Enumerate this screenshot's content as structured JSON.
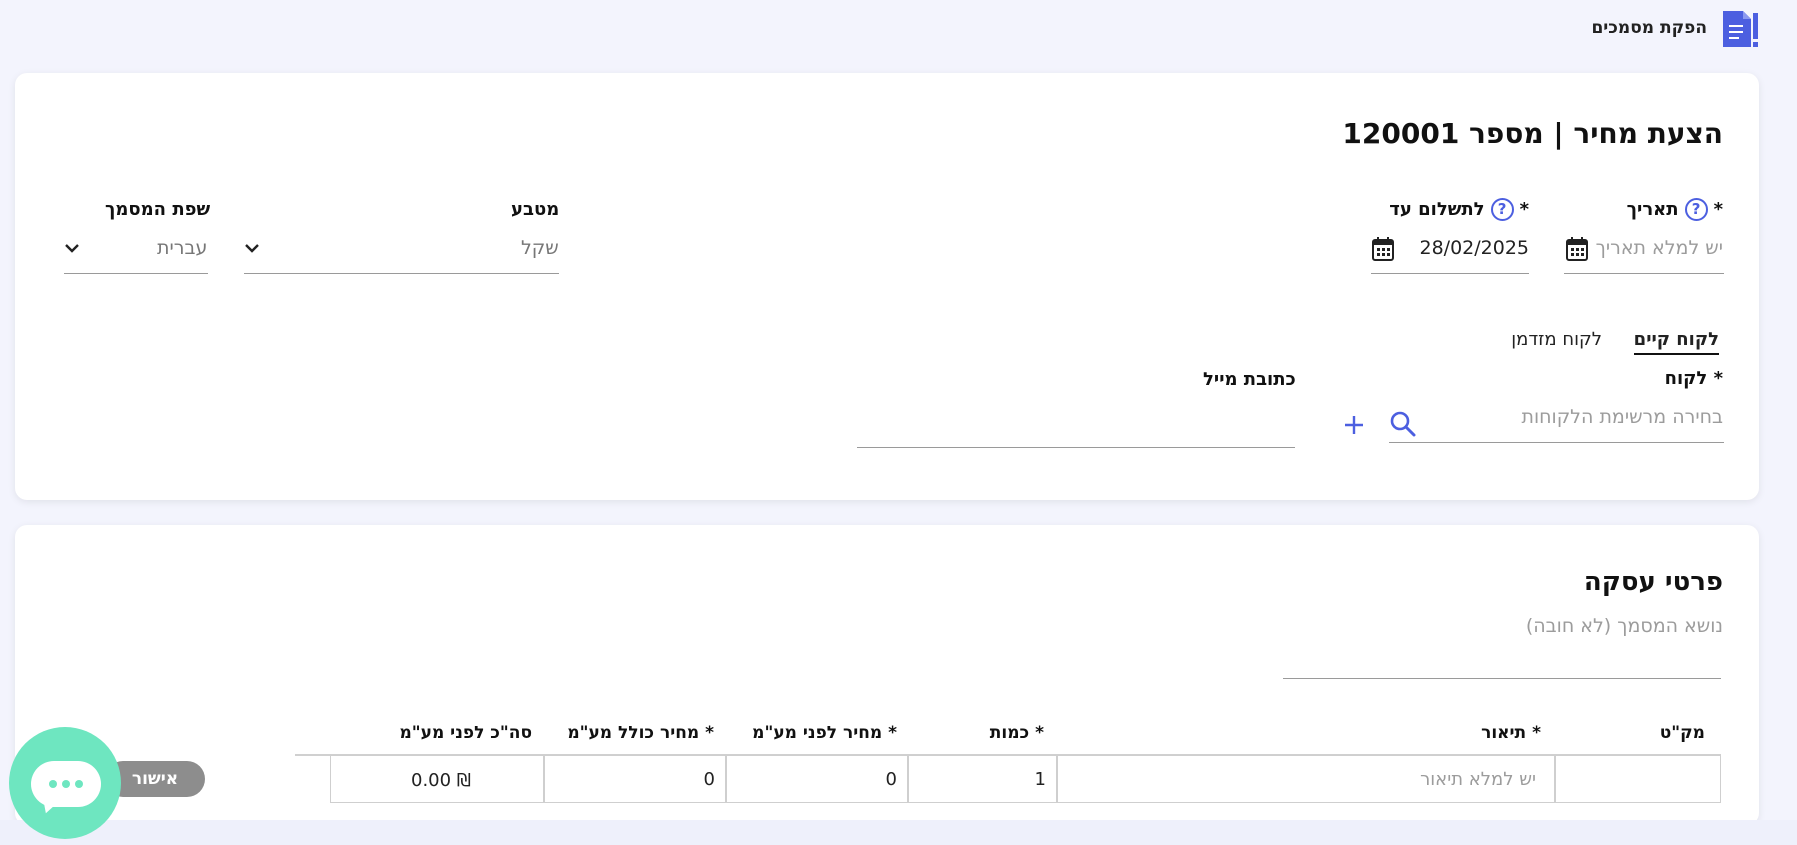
{
  "header": {
    "app_title": "הפקת מסמכים",
    "icon": "document-icon"
  },
  "document": {
    "title": "הצעת מחיר | מספר 120001",
    "date": {
      "label": "תאריך",
      "required": "*",
      "placeholder": "יש למלא תאריך"
    },
    "due_date": {
      "label": "לתשלום עד",
      "required": "*",
      "value": "28/02/2025"
    },
    "currency": {
      "label": "מטבע",
      "value": "שקל"
    },
    "language": {
      "label": "שפת המסמך",
      "value": "עברית"
    }
  },
  "customer": {
    "tabs": [
      {
        "label": "לקוח קיים",
        "active": true
      },
      {
        "label": "לקוח מזדמן",
        "active": false
      }
    ],
    "customer_label": "לקוח *",
    "customer_placeholder": "בחירה מרשימת הלקוחות",
    "email_label": "כתובת מייל",
    "email_value": ""
  },
  "deal": {
    "title": "פרטי עסקה",
    "subject_placeholder": "נושא המסמך (לא חובה)",
    "columns": [
      "מק\"ט",
      "תיאור *",
      "כמות *",
      "מחיר לפני מע\"מ *",
      "מחיר כולל מע\"מ *",
      "סה\"כ לפני מע\"מ"
    ],
    "row": {
      "sku": "",
      "description_placeholder": "יש למלא תיאור",
      "quantity": "1",
      "price_before_vat": "0",
      "price_with_vat": "0",
      "total_before_vat": "0.00 ₪"
    },
    "approve_label": "אישור"
  },
  "colors": {
    "accent": "#4c5fe0",
    "chat": "#6ee6c0",
    "approve": "#8d8d8d"
  }
}
